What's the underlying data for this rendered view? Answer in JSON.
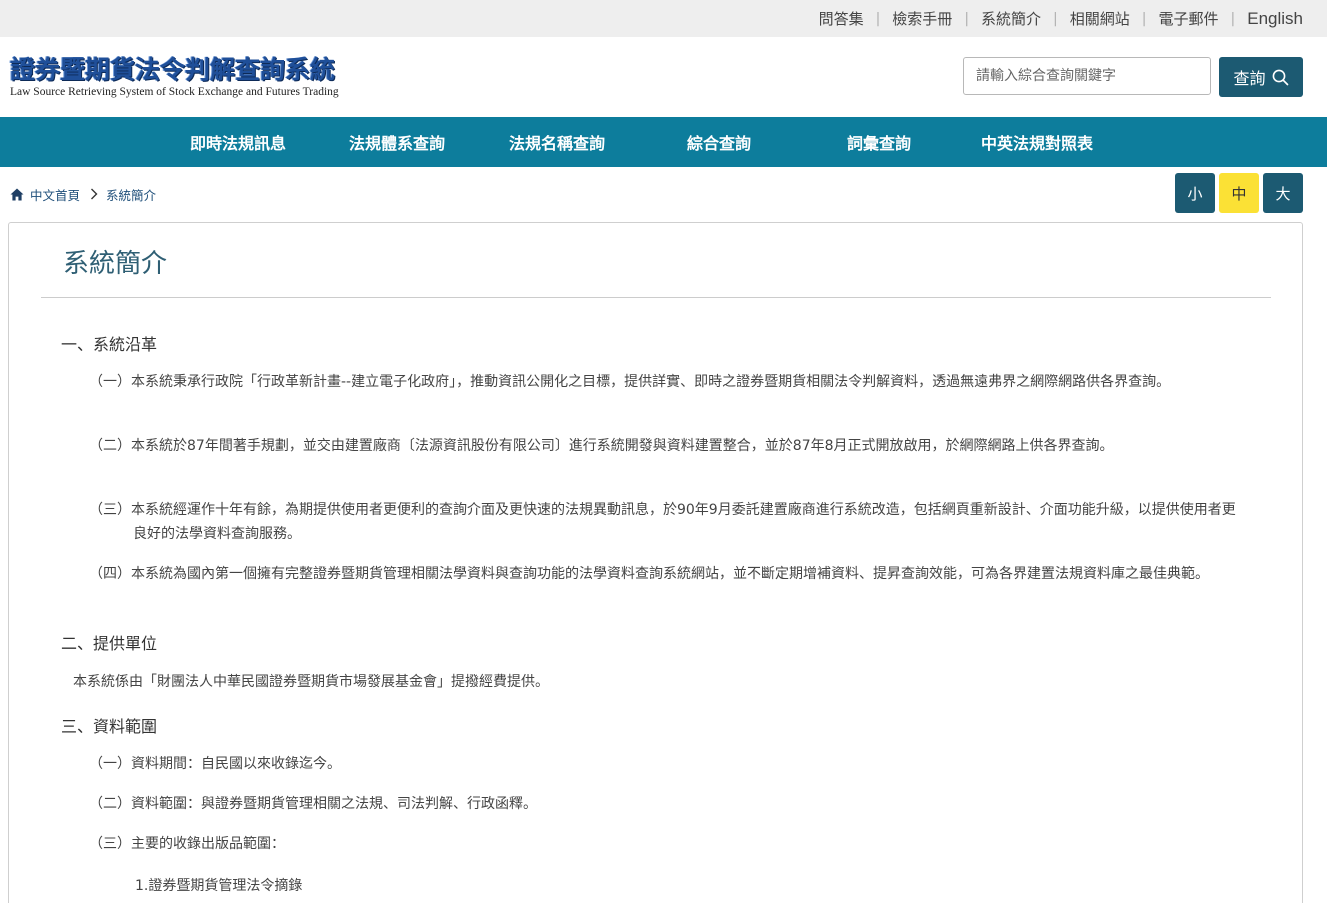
{
  "top_links": [
    "問答集",
    "檢索手冊",
    "系統簡介",
    "相關網站",
    "電子郵件",
    "English"
  ],
  "logo": {
    "title": "證券暨期貨法令判解查詢系統",
    "subtitle": "Law Source Retrieving System of Stock Exchange and Futures Trading"
  },
  "search": {
    "placeholder": "請輸入綜合查詢關鍵字",
    "button_label": "查詢"
  },
  "nav": [
    "即時法規訊息",
    "法規體系查詢",
    "法規名稱查詢",
    "綜合查詢",
    "詞彙查詢",
    "中英法規對照表"
  ],
  "breadcrumb": [
    "中文首頁",
    "系統簡介"
  ],
  "font_sizes": [
    "小",
    "中",
    "大"
  ],
  "colors": {
    "nav_bg": "#0d7d9c",
    "button_dark": "#1c5a72",
    "font_active": "#fbe135"
  },
  "content": {
    "title": "系統簡介",
    "sections": [
      {
        "heading": "一、系統沿革",
        "items": [
          "（一）本系統秉承行政院「行政革新計畫--建立電子化政府」，推動資訊公開化之目標，提供詳實、即時之證券暨期貨相關法令判解資料，透過無遠弗界之網際網路供各界查詢。",
          "（二）本系統於87年間著手規劃，並交由建置廠商〔法源資訊股份有限公司〕進行系統開發與資料建置整合，並於87年8月正式開放啟用，於網際網路上供各界查詢。",
          "（三）本系統經運作十年有餘，為期提供使用者更便利的查詢介面及更快速的法規異動訊息，於90年9月委託建置廠商進行系統改造，包括網頁重新設計、介面功能升級，以提供使用者更良好的法學資料查詢服務。",
          "（四）本系統為國內第一個擁有完整證券暨期貨管理相關法學資料與查詢功能的法學資料查詢系統網站，並不斷定期增補資料、提昇查詢效能，可為各界建置法規資料庫之最佳典範。"
        ]
      },
      {
        "heading": "二、提供單位",
        "text": "本系統係由「財團法人中華民國證券暨期貨市場發展基金會」提撥經費提供。"
      },
      {
        "heading": "三、資料範圍",
        "items": [
          "（一）資料期間：自民國以來收錄迄今。",
          "（二）資料範圍：與證券暨期貨管理相關之法規、司法判解、行政函釋。",
          "（三）主要的收錄出版品範圍："
        ],
        "subitems": [
          "1.證券暨期貨管理法令摘錄"
        ]
      }
    ]
  }
}
